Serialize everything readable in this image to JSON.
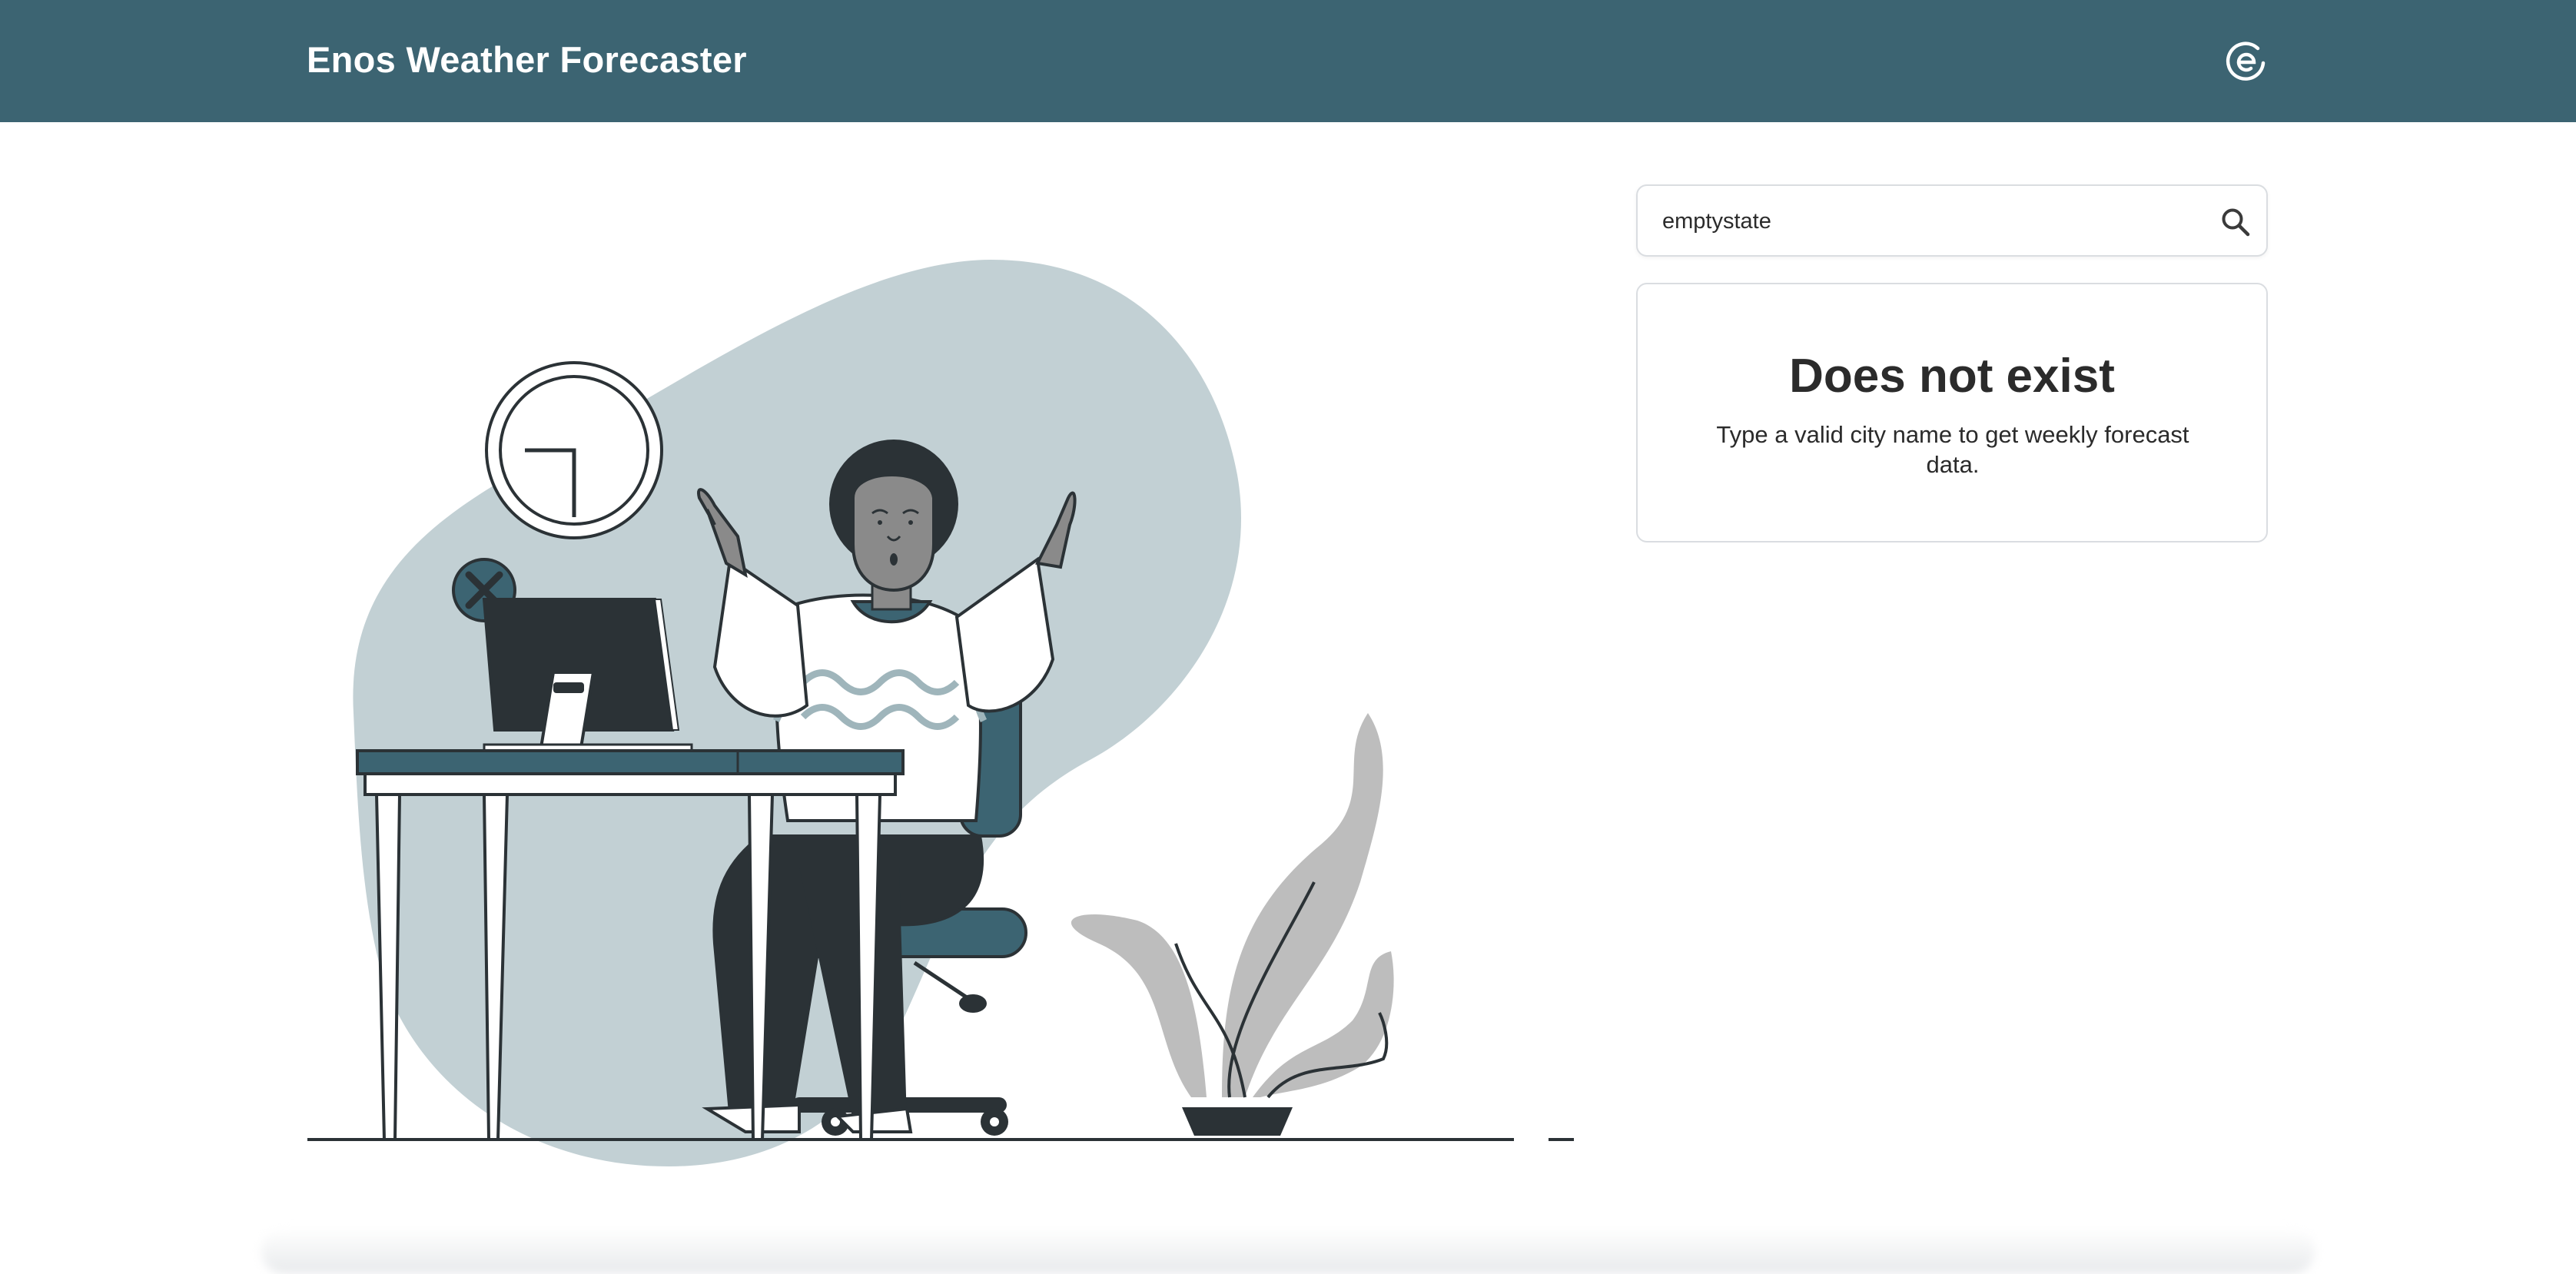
{
  "header": {
    "title": "Enos Weather Forecaster",
    "logo_icon": "enos-e-logo-icon",
    "background": "#3c6472"
  },
  "search": {
    "value": "emptystate",
    "placeholder": "",
    "icon": "search-icon"
  },
  "result": {
    "title": "Does not exist",
    "message": "Type a valid city name to get weekly forecast data."
  },
  "illustration": {
    "subject": "person-shrugging-at-desk",
    "accent_color": "#3c6472",
    "blob_color": "#c2d0d4",
    "plant_color": "#bdbdbd"
  }
}
